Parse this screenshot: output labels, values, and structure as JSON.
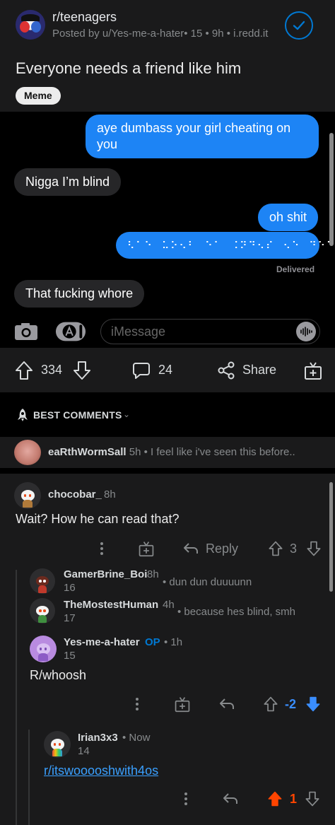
{
  "post": {
    "subreddit": "r/teenagers",
    "meta": "Posted by u/Yes-me-a-hater• 15 • 9h • i.redd.it",
    "title": "Everyone needs a friend like him",
    "flair": "Meme"
  },
  "imessage": {
    "bubbles": [
      {
        "dir": "out",
        "text": "aye dumbass your girl cheating on you"
      },
      {
        "dir": "in",
        "text": "Nigga I’m blind"
      },
      {
        "dir": "out",
        "text": "oh shit"
      },
      {
        "dir": "out",
        "text": "⠣⠁⠑⠀⠥⠕⠢⠃⠀⠑⠁⠀⠨⠝⠙⠢⠎⠀⠢⠑⠀⠙⠑⠁"
      },
      {
        "dir": "in",
        "text": "That fucking whore"
      }
    ],
    "delivered": "Delivered",
    "input_placeholder": "iMessage"
  },
  "actions": {
    "upvotes": "334",
    "comments": "24",
    "share": "Share"
  },
  "sort": {
    "label": "BEST COMMENTS"
  },
  "collapsed_comment": {
    "author": "eaRthWormSall",
    "time": "5h",
    "preview": "I feel like i've seen this before.."
  },
  "comments": [
    {
      "author": "chocobar_",
      "time": "8h",
      "text": "Wait? How he can read that?",
      "reply_label": "Reply",
      "votes": "3"
    },
    {
      "author": "GamerBrine_Boi",
      "time": "8h",
      "votes": "16",
      "preview": "dun dun duuuunn"
    },
    {
      "author": "TheMostestHuman",
      "time": "4h",
      "votes": "17",
      "preview": "because hes blind, smh"
    },
    {
      "author": "Yes-me-a-hater",
      "op_tag": "OP",
      "time": "1h",
      "votes": "15",
      "text": "R/whoosh",
      "score": "-2"
    },
    {
      "author": "Irian3x3",
      "time": "Now",
      "votes": "14",
      "link": "r/itswooooshwith4os",
      "score": "1"
    }
  ],
  "colors": {
    "accent_blue": "#0079d3",
    "imessage_blue": "#1d84f5",
    "upvote_orange": "#ff4500",
    "downvote_blue": "#3a8eff"
  }
}
